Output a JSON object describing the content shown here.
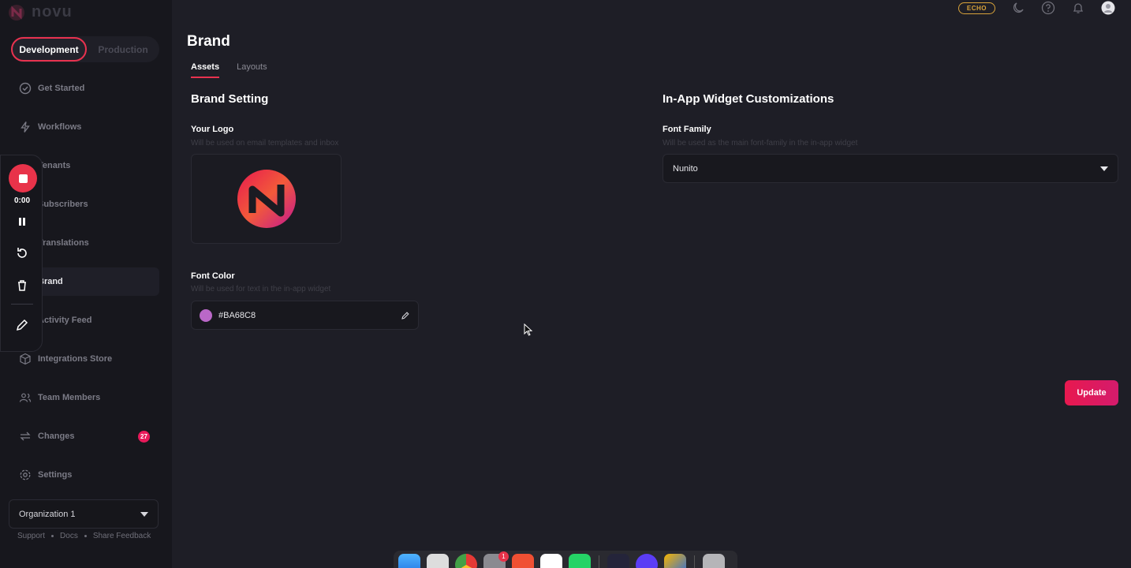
{
  "app": {
    "brand": "novu"
  },
  "env": {
    "development": "Development",
    "production": "Production",
    "active": "Development"
  },
  "sidebar": {
    "items": [
      {
        "label": "Get Started",
        "icon": "check-circle-icon"
      },
      {
        "label": "Workflows",
        "icon": "bolt-icon"
      },
      {
        "label": "Tenants",
        "icon": "tenants-icon"
      },
      {
        "label": "Subscribers",
        "icon": "users-icon"
      },
      {
        "label": "Translations",
        "icon": "translate-icon"
      },
      {
        "label": "Brand",
        "icon": "palette-icon"
      },
      {
        "label": "Activity Feed",
        "icon": "activity-icon"
      },
      {
        "label": "Integrations Store",
        "icon": "box-icon"
      },
      {
        "label": "Team Members",
        "icon": "team-icon"
      },
      {
        "label": "Changes",
        "icon": "changes-icon",
        "badge": "27"
      },
      {
        "label": "Settings",
        "icon": "gear-icon"
      }
    ],
    "active": "Brand",
    "organization": "Organization 1",
    "footer": {
      "support": "Support",
      "docs": "Docs",
      "feedback": "Share Feedback"
    }
  },
  "recorder": {
    "time": "0:00"
  },
  "topbar": {
    "echo": "ECHO"
  },
  "page": {
    "title": "Brand",
    "tabs": [
      {
        "label": "Assets"
      },
      {
        "label": "Layouts"
      }
    ],
    "active_tab": "Assets"
  },
  "brand_setting": {
    "title": "Brand Setting",
    "logo_label": "Your Logo",
    "logo_hint": "Will be used on email templates and inbox",
    "font_color_label": "Font Color",
    "font_color_hint": "Will be used for text in the in-app widget",
    "font_color_value": "#BA68C8"
  },
  "widget": {
    "title": "In-App Widget Customizations",
    "font_family_label": "Font Family",
    "font_family_hint": "Will be used as the main font-family in the in-app widget",
    "font_family_value": "Nunito"
  },
  "actions": {
    "update": "Update"
  },
  "colors": {
    "accent": "#e8324f",
    "badge": "#e8195a",
    "font_color": "#BA68C8",
    "echo": "#d8a33a"
  },
  "dock": {
    "apps": [
      "finder-icon",
      "launchpad-icon",
      "chrome-icon",
      "system-settings-icon",
      "git-icon",
      "vscode-icon",
      "whatsapp-icon",
      "github-desktop-icon",
      "screen-recorder-icon",
      "reeder-icon",
      "trash-icon"
    ],
    "settings_badge": "1"
  }
}
